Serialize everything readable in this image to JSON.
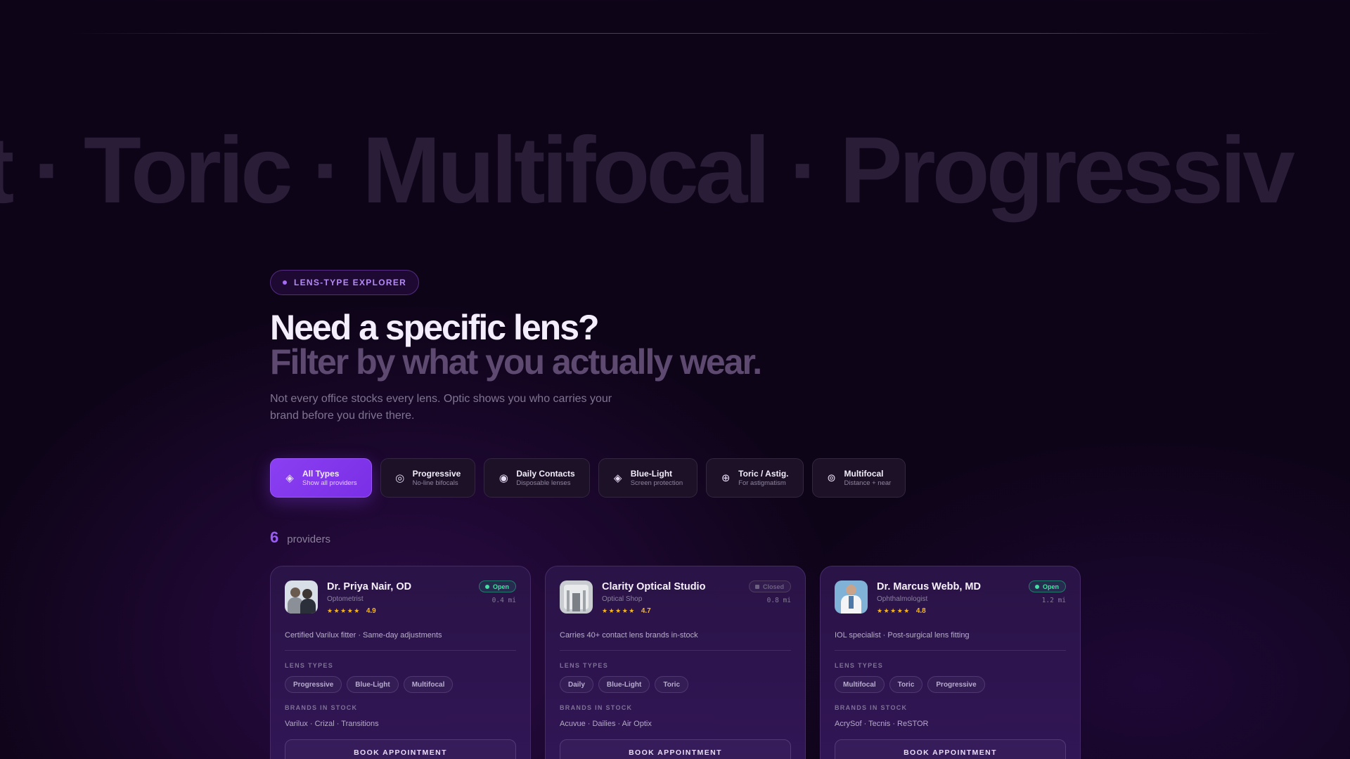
{
  "marquee": {
    "words": [
      "ght",
      "Toric",
      "Multifocal",
      "Progressiv"
    ],
    "separator": "·"
  },
  "hero": {
    "pill_label": "LENS-TYPE EXPLORER",
    "title": "Need a specific lens?",
    "subtitle": "Filter by what you actually wear.",
    "lede": "Not every office stocks every lens. Optic shows you who carries your brand before you drive there."
  },
  "filters": [
    {
      "icon": "◈",
      "icon_name": "diamond-icon",
      "title": "All Types",
      "sub": "Show all providers",
      "active": true
    },
    {
      "icon": "◎",
      "icon_name": "target-icon",
      "title": "Progressive",
      "sub": "No-line bifocals",
      "active": false
    },
    {
      "icon": "◉",
      "icon_name": "eye-icon",
      "title": "Daily Contacts",
      "sub": "Disposable lenses",
      "active": false
    },
    {
      "icon": "◈",
      "icon_name": "diamond-icon",
      "title": "Blue-Light",
      "sub": "Screen protection",
      "active": false
    },
    {
      "icon": "⊕",
      "icon_name": "crosshair-icon",
      "title": "Toric / Astig.",
      "sub": "For astigmatism",
      "active": false
    },
    {
      "icon": "⊚",
      "icon_name": "rings-icon",
      "title": "Multifocal",
      "sub": "Distance + near",
      "active": false
    }
  ],
  "results": {
    "count": "6",
    "label": "providers"
  },
  "labels": {
    "lens_types": "LENS TYPES",
    "brands": "BRANDS IN STOCK",
    "book": "BOOK APPOINTMENT"
  },
  "providers": [
    {
      "name": "Dr. Priya Nair, OD",
      "role": "Optometrist",
      "stars": "★★★★★",
      "rating": "4.9",
      "status": "Open",
      "open": true,
      "distance": "0.4 mi",
      "blurb": "Certified Varilux fitter · Same-day adjustments",
      "tags": [
        "Progressive",
        "Blue-Light",
        "Multifocal"
      ],
      "brands": "Varilux · Crizal · Transitions",
      "avatar": "people"
    },
    {
      "name": "Clarity Optical Studio",
      "role": "Optical Shop",
      "stars": "★★★★★",
      "rating": "4.7",
      "status": "Closed",
      "open": false,
      "distance": "0.8 mi",
      "blurb": "Carries 40+ contact lens brands in-stock",
      "tags": [
        "Daily",
        "Blue-Light",
        "Toric"
      ],
      "brands": "Acuvue · Dailies · Air Optix",
      "avatar": "shop"
    },
    {
      "name": "Dr. Marcus Webb, MD",
      "role": "Ophthalmologist",
      "stars": "★★★★★",
      "rating": "4.8",
      "status": "Open",
      "open": true,
      "distance": "1.2 mi",
      "blurb": "IOL specialist · Post-surgical lens fitting",
      "tags": [
        "Multifocal",
        "Toric",
        "Progressive"
      ],
      "brands": "AcrySof · Tecnis · ReSTOR",
      "avatar": "doc"
    }
  ]
}
